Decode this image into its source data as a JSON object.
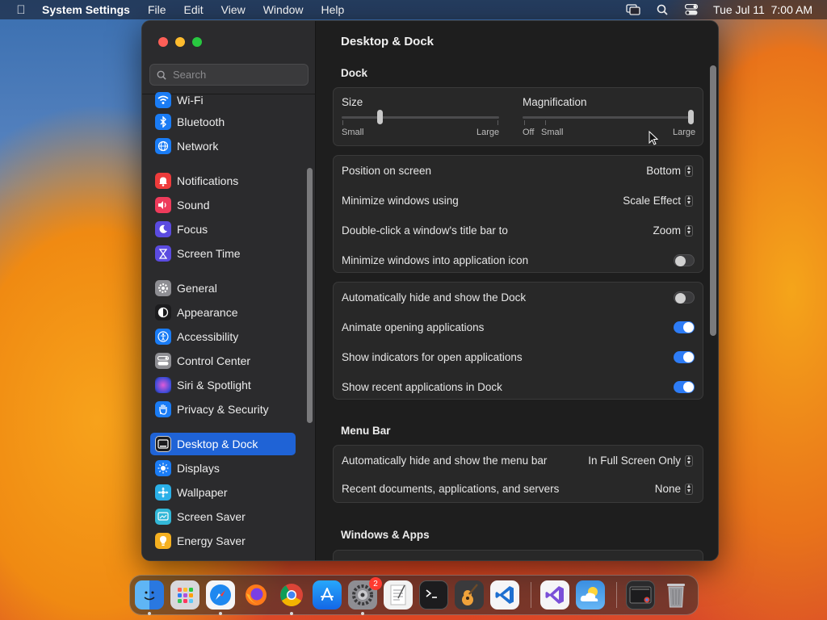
{
  "menubar": {
    "app_name": "System Settings",
    "menus": [
      "File",
      "Edit",
      "View",
      "Window",
      "Help"
    ],
    "clock": "Tue Jul 11  7:00 AM"
  },
  "sidebar": {
    "search_placeholder": "Search",
    "items": [
      {
        "label": "Wi-Fi",
        "icon": "wifi-icon",
        "color": "#1a7cf5"
      },
      {
        "label": "Bluetooth",
        "icon": "bluetooth-icon",
        "color": "#1a7cf5"
      },
      {
        "label": "Network",
        "icon": "globe-icon",
        "color": "#1a7cf5"
      },
      {
        "label": "Notifications",
        "icon": "bell-icon",
        "color": "#ee3b3b"
      },
      {
        "label": "Sound",
        "icon": "speaker-icon",
        "color": "#ee3b5b"
      },
      {
        "label": "Focus",
        "icon": "moon-icon",
        "color": "#5b4be0"
      },
      {
        "label": "Screen Time",
        "icon": "hourglass-icon",
        "color": "#5b4be0"
      },
      {
        "label": "General",
        "icon": "gear-icon",
        "color": "#8e8e93"
      },
      {
        "label": "Appearance",
        "icon": "appearance-icon",
        "color": "#1c1c1e"
      },
      {
        "label": "Accessibility",
        "icon": "accessibility-icon",
        "color": "#1a7cf5"
      },
      {
        "label": "Control Center",
        "icon": "control-center-icon",
        "color": "#8e8e93"
      },
      {
        "label": "Siri & Spotlight",
        "icon": "siri-icon",
        "color": "#3b3bb0"
      },
      {
        "label": "Privacy & Security",
        "icon": "hand-icon",
        "color": "#1a7cf5"
      },
      {
        "label": "Desktop & Dock",
        "icon": "desktop-icon",
        "color": "#1c1c1e"
      },
      {
        "label": "Displays",
        "icon": "sun-icon",
        "color": "#1a7cf5"
      },
      {
        "label": "Wallpaper",
        "icon": "wallpaper-icon",
        "color": "#2ab0e8"
      },
      {
        "label": "Screen Saver",
        "icon": "screensaver-icon",
        "color": "#33b8d8"
      },
      {
        "label": "Energy Saver",
        "icon": "bulb-icon",
        "color": "#f5b020"
      }
    ],
    "selected": "Desktop & Dock"
  },
  "content": {
    "title": "Desktop & Dock",
    "dock_section": "Dock",
    "size": {
      "label": "Size",
      "min_label": "Small",
      "max_label": "Large",
      "value_fraction": 0.24
    },
    "magnification": {
      "label": "Magnification",
      "off_label": "Off",
      "min_label": "Small",
      "max_label": "Large",
      "value_fraction": 1.0
    },
    "popups": [
      {
        "label": "Position on screen",
        "value": "Bottom"
      },
      {
        "label": "Minimize windows using",
        "value": "Scale Effect"
      },
      {
        "label": "Double-click a window's title bar to",
        "value": "Zoom"
      }
    ],
    "minimize_into_icon": {
      "label": "Minimize windows into application icon",
      "on": false
    },
    "toggles": [
      {
        "label": "Automatically hide and show the Dock",
        "on": false
      },
      {
        "label": "Animate opening applications",
        "on": true
      },
      {
        "label": "Show indicators for open applications",
        "on": true
      },
      {
        "label": "Show recent applications in Dock",
        "on": true
      }
    ],
    "menubar_section": "Menu Bar",
    "menubar_rows": [
      {
        "label": "Automatically hide and show the menu bar",
        "value": "In Full Screen Only"
      },
      {
        "label": "Recent documents, applications, and servers",
        "value": "None"
      }
    ],
    "windows_section": "Windows & Apps"
  },
  "dock": {
    "apps": [
      {
        "name": "finder-icon",
        "color": "#2b8ef0",
        "running": true
      },
      {
        "name": "launchpad-icon",
        "color": "#d8d8dc",
        "running": false
      },
      {
        "name": "safari-icon",
        "color": "#1e88f0",
        "running": true
      },
      {
        "name": "firefox-icon",
        "color": "#ff6a1a",
        "running": false
      },
      {
        "name": "chrome-icon",
        "color": "#e8e8e8",
        "running": true
      },
      {
        "name": "app-store-icon",
        "color": "#1a8cf5",
        "running": false
      },
      {
        "name": "system-settings-icon",
        "color": "#8e8e93",
        "running": true,
        "badge": "2"
      },
      {
        "name": "textedit-icon",
        "color": "#f2f2f2",
        "running": false
      },
      {
        "name": "terminal-icon",
        "color": "#1c1c1e",
        "running": false
      },
      {
        "name": "garageband-icon",
        "color": "#3a3a3c",
        "running": false
      },
      {
        "name": "vscode-icon",
        "color": "#1e6fd0",
        "running": false
      },
      {
        "name": "visual-studio-icon",
        "color": "#7a4fd8",
        "running": false
      },
      {
        "name": "weather-icon",
        "color": "#3a8ee0",
        "running": false
      },
      {
        "name": "recent-window-icon",
        "color": "#2a2a2c",
        "running": false
      },
      {
        "name": "trash-icon",
        "color": "#9a9a9e",
        "running": false
      }
    ],
    "settings_badge": "2"
  }
}
